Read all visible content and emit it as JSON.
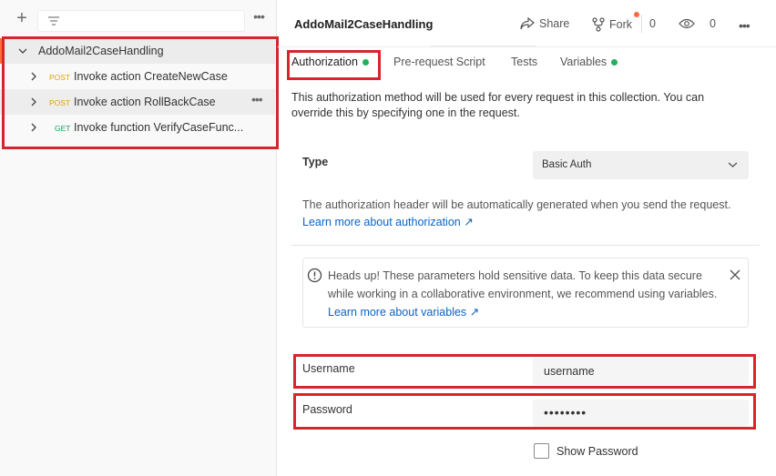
{
  "sidebar": {
    "collection_name": "AddoMail2CaseHandling",
    "requests": [
      {
        "method": "POST",
        "name": "Invoke action CreateNewCase"
      },
      {
        "method": "POST",
        "name": "Invoke action RollBackCase"
      },
      {
        "method": "GET",
        "name": "Invoke function VerifyCaseFunc..."
      }
    ]
  },
  "header": {
    "title": "AddoMail2CaseHandling",
    "share_label": "Share",
    "fork_label": "Fork",
    "fork_count": "0",
    "watch_count": "0"
  },
  "tabs": [
    {
      "label": "Authorization",
      "active": true,
      "dot": true
    },
    {
      "label": "Pre-request Script",
      "active": false,
      "dot": false
    },
    {
      "label": "Tests",
      "active": false,
      "dot": false
    },
    {
      "label": "Variables",
      "active": false,
      "dot": true
    }
  ],
  "auth": {
    "description": "This authorization method will be used for every request in this collection. You can override this by specifying one in the request.",
    "type_label": "Type",
    "type_value": "Basic Auth",
    "note": "The authorization header will be automatically generated when you send the request.",
    "note_link": "Learn more about authorization ↗",
    "alert_text": "Heads up! These parameters hold sensitive data. To keep this data secure while working in a collaborative environment, we recommend using variables.",
    "alert_link": "Learn more about variables ↗",
    "username_label": "Username",
    "username_value": "username",
    "password_label": "Password",
    "password_value": "••••••••",
    "show_password_label": "Show Password"
  },
  "colors": {
    "accent": "#ff6c37",
    "highlight": "#d7262b",
    "dot_green": "#1fb25a",
    "post": "#e6a100",
    "get": "#19a05a",
    "link": "#0b63c7"
  }
}
